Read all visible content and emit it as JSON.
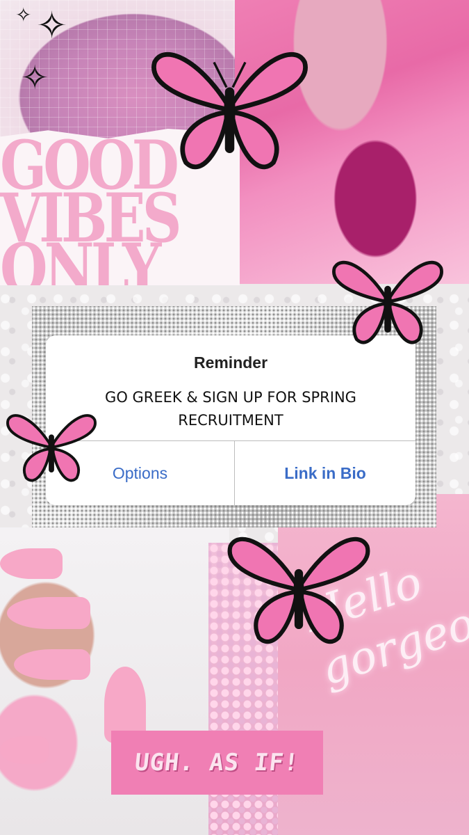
{
  "background": {
    "poster_text": [
      "GOOD",
      "VIBES",
      "ONLY"
    ],
    "neon_text": [
      "Hello",
      "gorgeous"
    ],
    "sticker_text": "UGH. AS IF!"
  },
  "reminder": {
    "title": "Reminder",
    "message": "GO GREEK & SIGN UP FOR SPRING RECRUITMENT",
    "options_label": "Options",
    "link_label": "Link in Bio"
  },
  "colors": {
    "accent_pink": "#f07fb4",
    "alert_button_blue": "#3a6cc7",
    "butterfly_pink": "#f075b2"
  },
  "icons": [
    "sparkle-icon",
    "butterfly-icon"
  ]
}
